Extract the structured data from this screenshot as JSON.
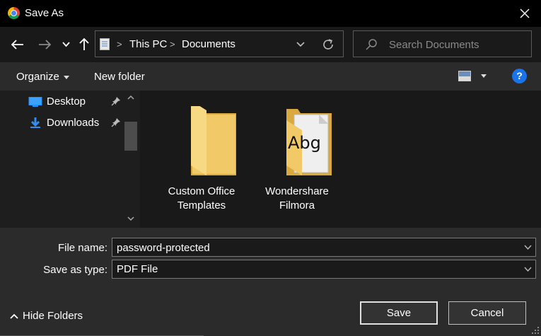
{
  "window": {
    "title": "Save As",
    "icon": "chrome-icon"
  },
  "nav": {
    "back_icon": "arrow-left-icon",
    "forward_icon": "arrow-right-icon",
    "recent_icon": "chevron-down-icon",
    "up_icon": "arrow-up-icon",
    "breadcrumb": [
      "This PC",
      "Documents"
    ],
    "refresh_icon": "refresh-icon",
    "search_placeholder": "Search Documents"
  },
  "toolbar": {
    "organize_label": "Organize",
    "new_folder_label": "New folder",
    "help_label": "?"
  },
  "sidebar": {
    "items": [
      {
        "label": "Desktop",
        "icon": "desktop-icon",
        "pinned": true
      },
      {
        "label": "Downloads",
        "icon": "download-icon",
        "pinned": true
      }
    ]
  },
  "files": [
    {
      "line1": "Custom Office",
      "line2": "Templates",
      "icon": "folder-icon"
    },
    {
      "line1": "Wondershare",
      "line2": "Filmora",
      "icon": "font-folder-icon",
      "badge_text": "Abg"
    }
  ],
  "form": {
    "file_name_label": "File name:",
    "file_name_value": "password-protected",
    "save_type_label": "Save as type:",
    "save_type_value": "PDF File"
  },
  "footer": {
    "hide_folders_label": "Hide Folders",
    "save_label": "Save",
    "cancel_label": "Cancel"
  },
  "colors": {
    "titlebar": "#000000",
    "folder": "#f2c967",
    "accent": "#1a73e8"
  }
}
